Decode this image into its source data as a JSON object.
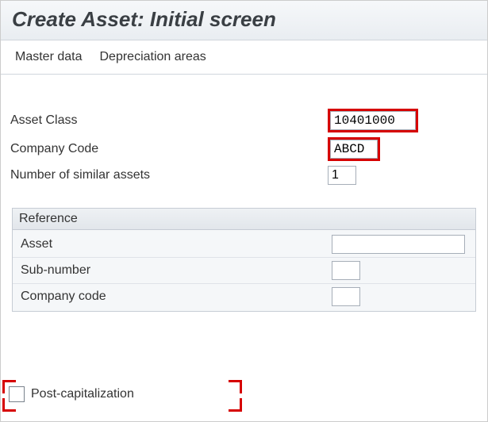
{
  "title": "Create Asset:  Initial screen",
  "menu": {
    "master_data": "Master data",
    "depr_areas": "Depreciation areas"
  },
  "fields": {
    "asset_class_label": "Asset Class",
    "asset_class_value": "10401000",
    "company_code_label": "Company Code",
    "company_code_value": "ABCD",
    "num_similar_label": "Number of similar assets",
    "num_similar_value": "1"
  },
  "reference": {
    "title": "Reference",
    "asset_label": "Asset",
    "asset_value": "",
    "subnumber_label": "Sub-number",
    "subnumber_value": "",
    "company_code_label": "Company code",
    "company_code_value": ""
  },
  "postcap": {
    "label": "Post-capitalization",
    "checked": false
  }
}
